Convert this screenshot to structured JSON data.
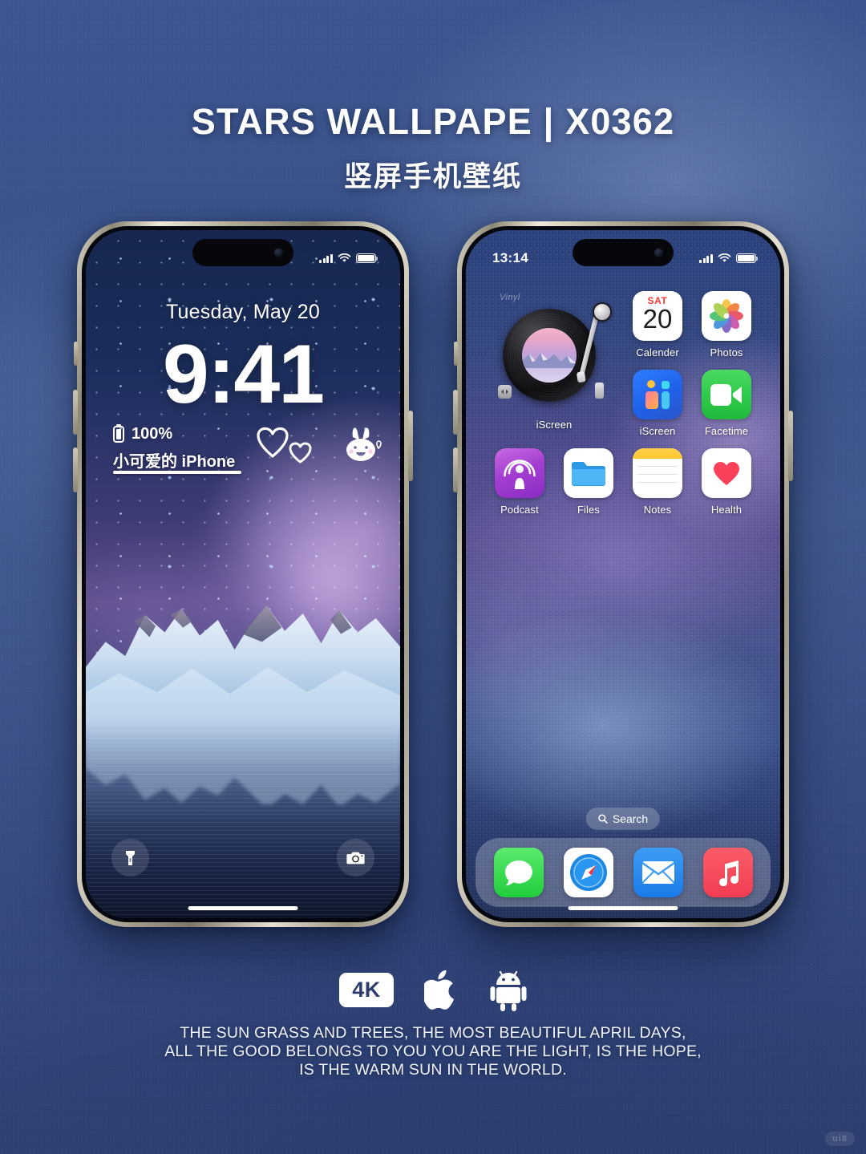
{
  "header": {
    "title": "STARS WALLPAPE | X0362",
    "subtitle": "竖屏手机壁纸"
  },
  "colors": {
    "background_top": "#3e5690",
    "background_bottom": "#2c3c6d",
    "accent_white": "#ffffff",
    "frame_titanium": "#b2ac9a"
  },
  "lock_screen": {
    "status_bar": {
      "time": "",
      "signal_icon": "cellular-bars-icon",
      "wifi_icon": "wifi-icon",
      "battery_icon": "battery-full-icon"
    },
    "date": "Tuesday, May 20",
    "time": "9:41",
    "battery_percent": "100%",
    "battery_icon": "battery-upright-icon",
    "device_name": "小可爱的 iPhone",
    "stickers": [
      "heart-outline-large",
      "heart-outline-small",
      "bunny-sticker"
    ],
    "flashlight_icon": "flashlight-icon",
    "camera_icon": "camera-icon",
    "home_indicator": "home-indicator"
  },
  "home_screen": {
    "status_bar": {
      "time": "13:14",
      "signal_icon": "cellular-bars-icon",
      "wifi_icon": "wifi-icon",
      "battery_icon": "battery-full-icon"
    },
    "widget": {
      "corner_label": "Vinyl",
      "label": "iScreen",
      "icon": "vinyl-record-widget"
    },
    "apps": [
      {
        "label": "Calender",
        "icon": "calendar-icon",
        "day_abbrev": "SAT",
        "day_number": "20"
      },
      {
        "label": "Photos",
        "icon": "photos-icon"
      },
      {
        "label": "iScreen",
        "icon": "iscreen-icon"
      },
      {
        "label": "Facetime",
        "icon": "facetime-icon"
      },
      {
        "label": "Podcast",
        "icon": "podcast-icon"
      },
      {
        "label": "Files",
        "icon": "files-icon"
      },
      {
        "label": "Notes",
        "icon": "notes-icon"
      },
      {
        "label": "Health",
        "icon": "health-icon"
      }
    ],
    "search": {
      "label": "Search",
      "icon": "search-icon"
    },
    "dock": [
      {
        "label": "Messages",
        "icon": "messages-icon"
      },
      {
        "label": "Safari",
        "icon": "safari-icon"
      },
      {
        "label": "Mail",
        "icon": "mail-icon"
      },
      {
        "label": "Music",
        "icon": "music-icon"
      }
    ]
  },
  "badges": [
    {
      "label": "4K",
      "icon": "resolution-4k-badge"
    },
    {
      "label": "Apple",
      "icon": "apple-logo-icon"
    },
    {
      "label": "Android",
      "icon": "android-robot-icon"
    }
  ],
  "footer": {
    "line1": "THE SUN GRASS AND TREES, THE MOST BEAUTIFUL APRIL DAYS,",
    "line2": "ALL THE GOOD BELONGS TO YOU YOU ARE THE LIGHT, IS THE HOPE,",
    "line3": "IS THE WARM SUN IN THE WORLD."
  },
  "watermark": {
    "label": "ui8"
  }
}
